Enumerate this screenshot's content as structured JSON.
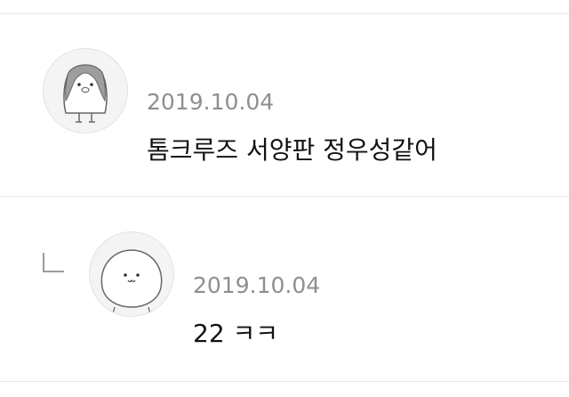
{
  "comments": [
    {
      "avatar_icon": "penguin-avatar-icon",
      "date": "2019.10.04",
      "text": "톰크루즈 서양판 정우성같어"
    },
    {
      "is_reply": true,
      "reply_icon": "reply-arrow-icon",
      "avatar_icon": "round-face-avatar-icon",
      "date": "2019.10.04",
      "text": "22 ㅋㅋ"
    }
  ],
  "colors": {
    "divider": "#e6e6e6",
    "date": "#8f8f8f",
    "text": "#111111"
  }
}
